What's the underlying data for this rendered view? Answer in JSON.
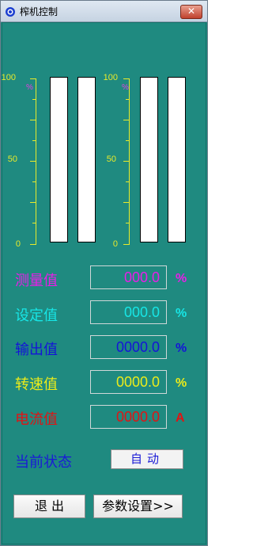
{
  "window": {
    "title": "榨机控制",
    "close_label": "✕"
  },
  "gauges": [
    {
      "scale_labels": {
        "max": "100",
        "mid": "50",
        "min": "0"
      },
      "unit": "%",
      "bars": [
        {
          "level": 0
        },
        {
          "level": 0
        }
      ]
    },
    {
      "scale_labels": {
        "max": "100",
        "mid": "50",
        "min": "0"
      },
      "unit": "%",
      "bars": [
        {
          "level": 0
        },
        {
          "level": 0
        }
      ]
    }
  ],
  "readings": [
    {
      "label": "测量值",
      "value": "000.0",
      "unit": "%",
      "color": "#e81ee8"
    },
    {
      "label": "设定值",
      "value": "000.0",
      "unit": "%",
      "color": "#17e6e6"
    },
    {
      "label": "输出值",
      "value": "0000.0",
      "unit": "%",
      "color": "#1414d8"
    },
    {
      "label": "转速值",
      "value": "0000.0",
      "unit": "%",
      "color": "#ecec1a"
    },
    {
      "label": "电流值",
      "value": "0000.0",
      "unit": "A",
      "color": "#e01414"
    }
  ],
  "status": {
    "label": "当前状态",
    "mode": "自动"
  },
  "buttons": {
    "exit": "退 出",
    "params": "参数设置>>"
  },
  "colors": {
    "background": "#1f8a80",
    "scale": "#e8ea2a"
  }
}
